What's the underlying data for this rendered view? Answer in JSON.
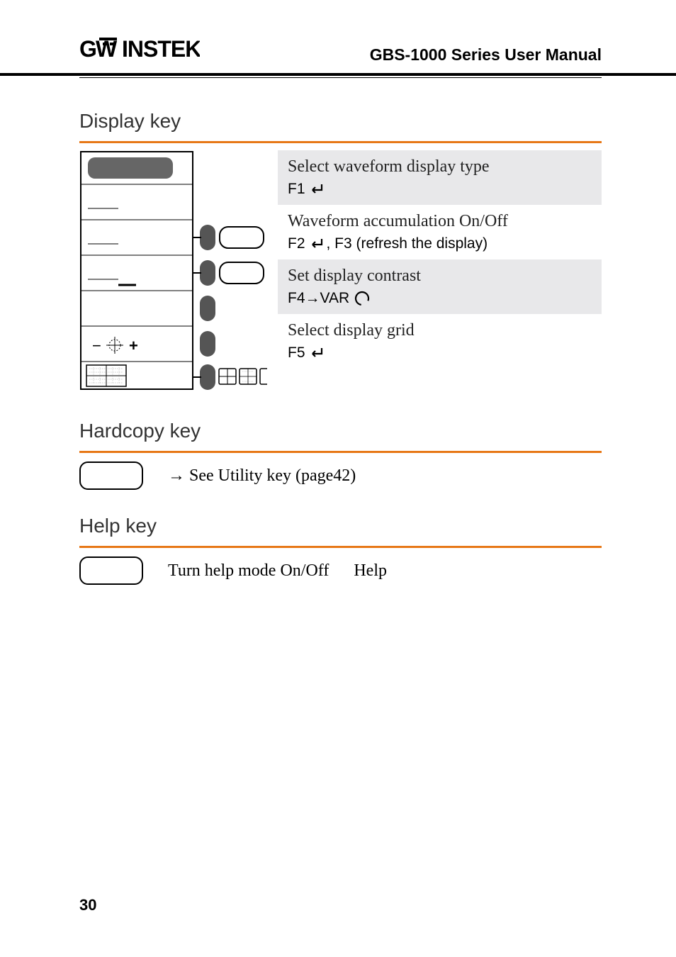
{
  "header": {
    "logo_text": "GWINSTEK",
    "manual_title": "GBS-1000 Series User Manual"
  },
  "display_key": {
    "title": "Display key",
    "rows": [
      {
        "title": "Select waveform display type",
        "key_text": "F1"
      },
      {
        "title": "Waveform accumulation On/Off",
        "key_text": "F2",
        "key_suffix": ", F3 (refresh the display)"
      },
      {
        "title": "Set display contrast",
        "key_text": "F4→VAR"
      },
      {
        "title": "Select display grid",
        "key_text": "F5"
      }
    ]
  },
  "hardcopy_key": {
    "title": "Hardcopy key",
    "text": "→ See Utility key (page42)"
  },
  "help_key": {
    "title": "Help key",
    "text1": "Turn help mode On/Off",
    "text2": "Help"
  },
  "page_number": "30"
}
